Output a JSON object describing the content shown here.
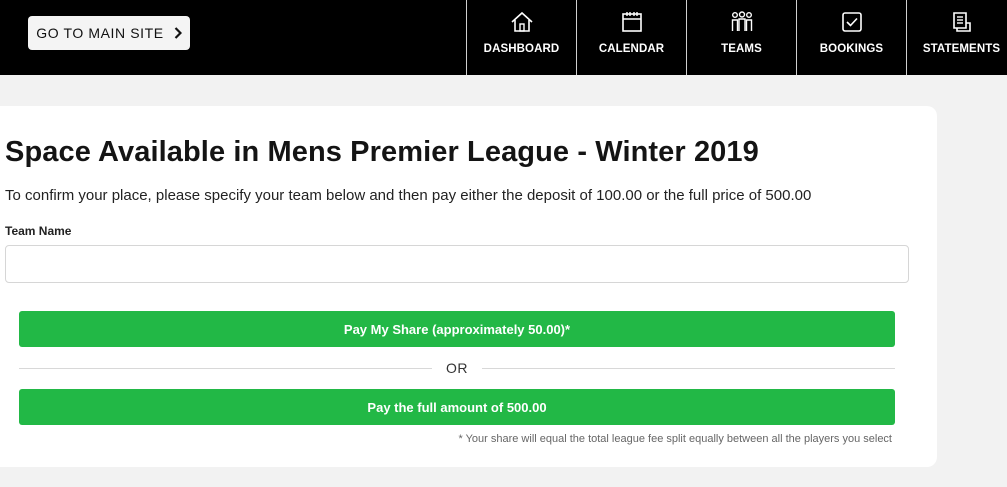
{
  "header": {
    "main_site_label": "GO TO MAIN SITE",
    "nav": [
      {
        "label": "DASHBOARD",
        "icon": "home-icon"
      },
      {
        "label": "CALENDAR",
        "icon": "calendar-icon"
      },
      {
        "label": "TEAMS",
        "icon": "team-icon"
      },
      {
        "label": "BOOKINGS",
        "icon": "checkbox-icon"
      },
      {
        "label": "STATEMENTS",
        "icon": "statement-icon"
      }
    ]
  },
  "main": {
    "title": "Space Available in Mens Premier League - Winter 2019",
    "description": "To confirm your place, please specify your team below and then pay either the deposit of 100.00 or the full price of 500.00",
    "team_name_label": "Team Name",
    "team_name_value": "",
    "team_name_placeholder": "",
    "pay_share_label": "Pay My Share (approximately 50.00)*",
    "or_label": "OR",
    "pay_full_label": "Pay the full amount of 500.00",
    "footnote": "* Your share will equal the total league fee split equally between all the players you select"
  },
  "colors": {
    "header_bg": "#000000",
    "button_green": "#22b846",
    "page_bg": "#f2f2f2"
  }
}
